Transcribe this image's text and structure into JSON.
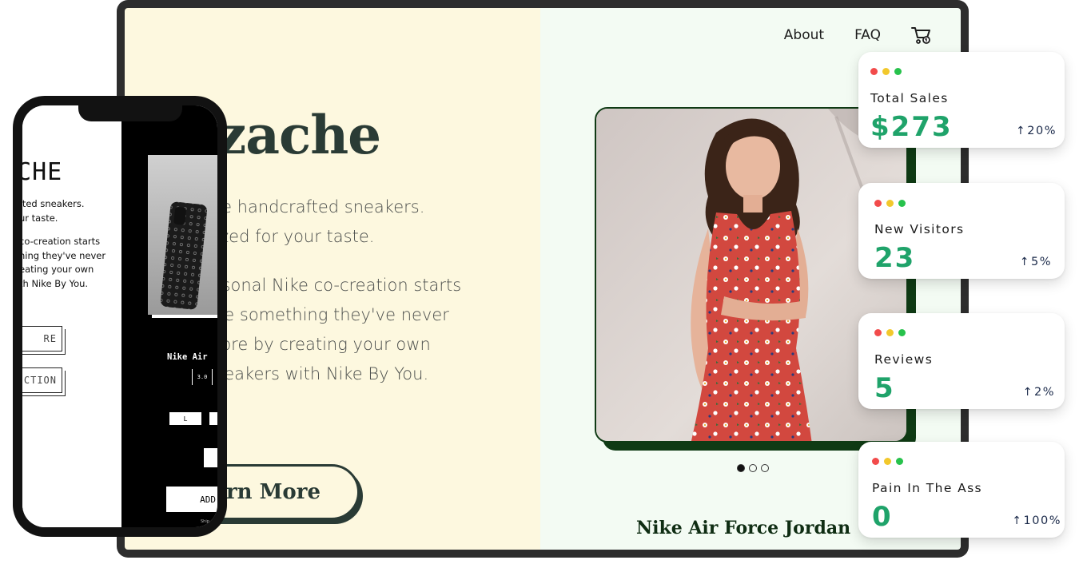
{
  "nav": {
    "about": "About",
    "faq": "FAQ",
    "cart_icon": "cart-icon"
  },
  "hero": {
    "brand": "erzache",
    "tagline_lines": [
      "ate handcrafted sneakers.",
      "nized for your taste."
    ],
    "blurb_lines": [
      "ersonal Nike co-creation starts",
      "ake something they've never",
      "efore by creating your own",
      "sneakers with Nike By You."
    ],
    "cta_label": "arn More"
  },
  "product": {
    "name": "Nike Air Force Jordan",
    "image": "woman-in-red-floral-dress-photo",
    "carousel": {
      "count": 3,
      "active": 1
    }
  },
  "phone": {
    "brand": "ACHE",
    "text1_lines": [
      "fted sneakers.",
      "ur taste."
    ],
    "text2_lines": [
      " co-creation starts",
      "hing they've never",
      "eating your own",
      "th Nike By You."
    ],
    "btn1_label": "RE",
    "btn2_label": "CTION",
    "product_name": "Nike Air",
    "size_label": "3.0",
    "option_label": "L",
    "add_label": "ADD",
    "footer_text": "Ship"
  },
  "stats": [
    {
      "label": "Total Sales",
      "value": "$273",
      "change": "20%",
      "direction": "up",
      "value_color": "#1fa36a"
    },
    {
      "label": "New Visitors",
      "value": "23",
      "change": "5%",
      "direction": "up",
      "value_color": "#1fa36a"
    },
    {
      "label": "Reviews",
      "value": "5",
      "change": "2%",
      "direction": "up",
      "value_color": "#1fa36a"
    },
    {
      "label": "Pain In The Ass",
      "value": "0",
      "change": "100%",
      "direction": "up",
      "value_color": "#1fa36a"
    }
  ],
  "colors": {
    "accent_green": "#1fa36a",
    "dark_green": "#0f3a14",
    "cream": "#fdf8df",
    "mint": "#f3fbf3"
  }
}
